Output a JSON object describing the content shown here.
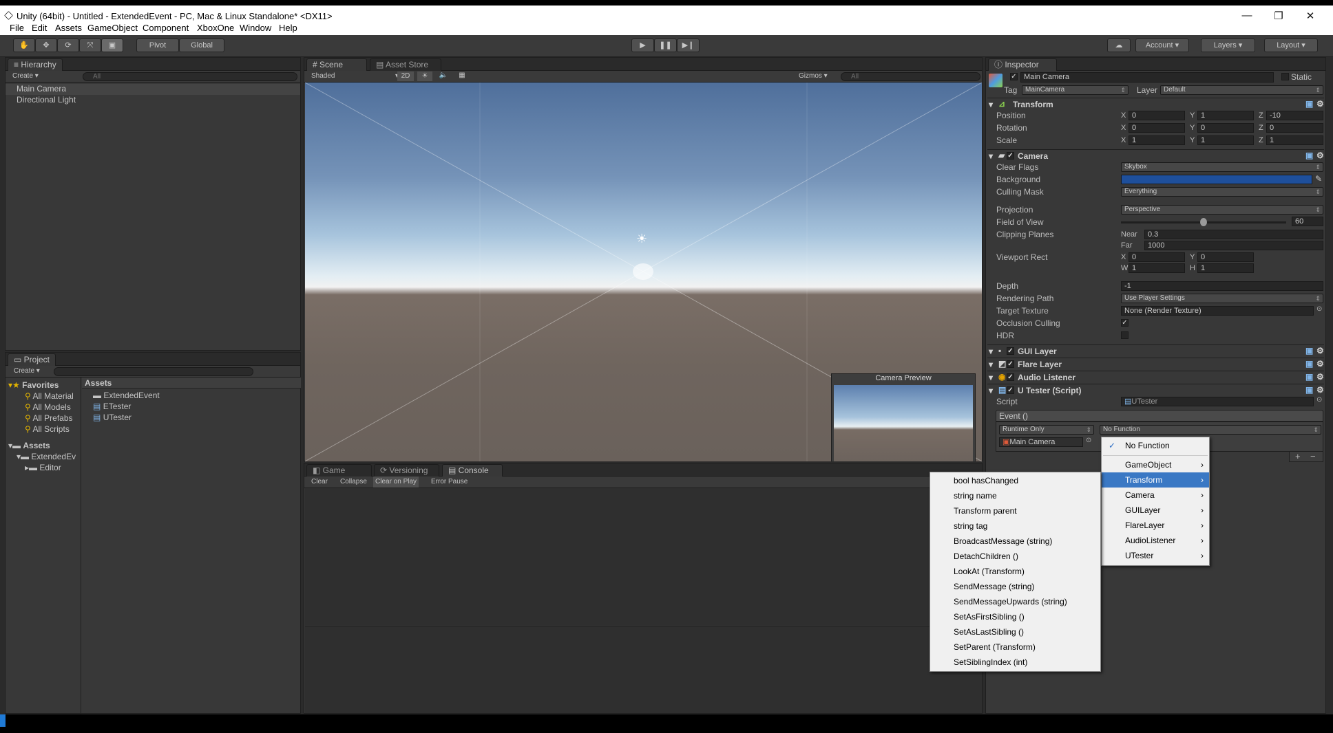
{
  "window": {
    "title": "Unity (64bit) - Untitled - ExtendedEvent - PC, Mac & Linux Standalone* <DX11>",
    "minimize": "—",
    "restore": "❐",
    "close": "✕"
  },
  "menubar": [
    "File",
    "Edit",
    "Assets",
    "GameObject",
    "Component",
    "XboxOne",
    "Window",
    "Help"
  ],
  "toolbar": {
    "pivot": "Pivot",
    "global": "Global",
    "account": "Account",
    "layers": "Layers",
    "layout": "Layout"
  },
  "hierarchy": {
    "tab": "Hierarchy",
    "create": "Create",
    "search_placeholder": "All",
    "items": [
      "Main Camera",
      "Directional Light"
    ]
  },
  "project": {
    "tab": "Project",
    "create": "Create",
    "favorites": "Favorites",
    "fav_items": [
      "All Material",
      "All Models",
      "All Prefabs",
      "All Scripts"
    ],
    "assets_root": "Assets",
    "tree": [
      "ExtendedEv",
      "Editor"
    ],
    "breadcrumb": "Assets",
    "files": [
      "ExtendedEvent",
      "ETester",
      "UTester"
    ]
  },
  "scene": {
    "tab": "Scene",
    "tab2": "Asset Store",
    "shading": "Shaded",
    "mode2d": "2D",
    "gizmos": "Gizmos",
    "search_placeholder": "All",
    "preview_title": "Camera Preview"
  },
  "console": {
    "tabs": [
      "Game",
      "Versioning",
      "Console"
    ],
    "buttons": [
      "Clear",
      "Collapse",
      "Clear on Play",
      "Error Pause"
    ]
  },
  "inspector": {
    "tab": "Inspector",
    "object_name": "Main Camera",
    "static": "Static",
    "tag_label": "Tag",
    "tag": "MainCamera",
    "layer_label": "Layer",
    "layer": "Default",
    "transform": {
      "title": "Transform",
      "position_label": "Position",
      "rotation_label": "Rotation",
      "scale_label": "Scale",
      "position": [
        "0",
        "1",
        "-10"
      ],
      "rotation": [
        "0",
        "0",
        "0"
      ],
      "scale": [
        "1",
        "1",
        "1"
      ],
      "axes": [
        "X",
        "Y",
        "Z"
      ]
    },
    "camera": {
      "title": "Camera",
      "clear_flags_label": "Clear Flags",
      "clear_flags": "Skybox",
      "background_label": "Background",
      "culling_label": "Culling Mask",
      "culling": "Everything",
      "projection_label": "Projection",
      "projection": "Perspective",
      "fov_label": "Field of View",
      "fov": "60",
      "fov_fraction": 0.5,
      "clipping_label": "Clipping Planes",
      "near_label": "Near",
      "near": "0.3",
      "far_label": "Far",
      "far": "1000",
      "viewport_label": "Viewport Rect",
      "vx": "0",
      "vy": "0",
      "vw": "1",
      "vh": "1",
      "xl": "X",
      "yl": "Y",
      "wl": "W",
      "hl": "H",
      "depth_label": "Depth",
      "depth": "-1",
      "rendering_label": "Rendering Path",
      "rendering": "Use Player Settings",
      "target_label": "Target Texture",
      "target": "None (Render Texture)",
      "occlusion_label": "Occlusion Culling",
      "hdr_label": "HDR",
      "bg_color": "#1e4f9b"
    },
    "components": [
      "GUI Layer",
      "Flare Layer",
      "Audio Listener",
      "U Tester (Script)"
    ],
    "script_label": "Script",
    "script": "UTester",
    "event_header": "Event ()",
    "runtime": "Runtime Only",
    "function": "No Function",
    "event_target": "Main Camera",
    "plus": "+",
    "minus": "−"
  },
  "function_menu": {
    "items": [
      "No Function",
      "GameObject",
      "Transform",
      "Camera",
      "GUILayer",
      "FlareLayer",
      "AudioListener",
      "UTester"
    ],
    "check": "✓",
    "arrow": "›"
  },
  "transform_submenu": {
    "items": [
      "bool hasChanged",
      "string name",
      "Transform parent",
      "string tag",
      "BroadcastMessage (string)",
      "DetachChildren ()",
      "LookAt (Transform)",
      "SendMessage (string)",
      "SendMessageUpwards (string)",
      "SetAsFirstSibling ()",
      "SetAsLastSibling ()",
      "SetParent (Transform)",
      "SetSiblingIndex (int)"
    ]
  }
}
